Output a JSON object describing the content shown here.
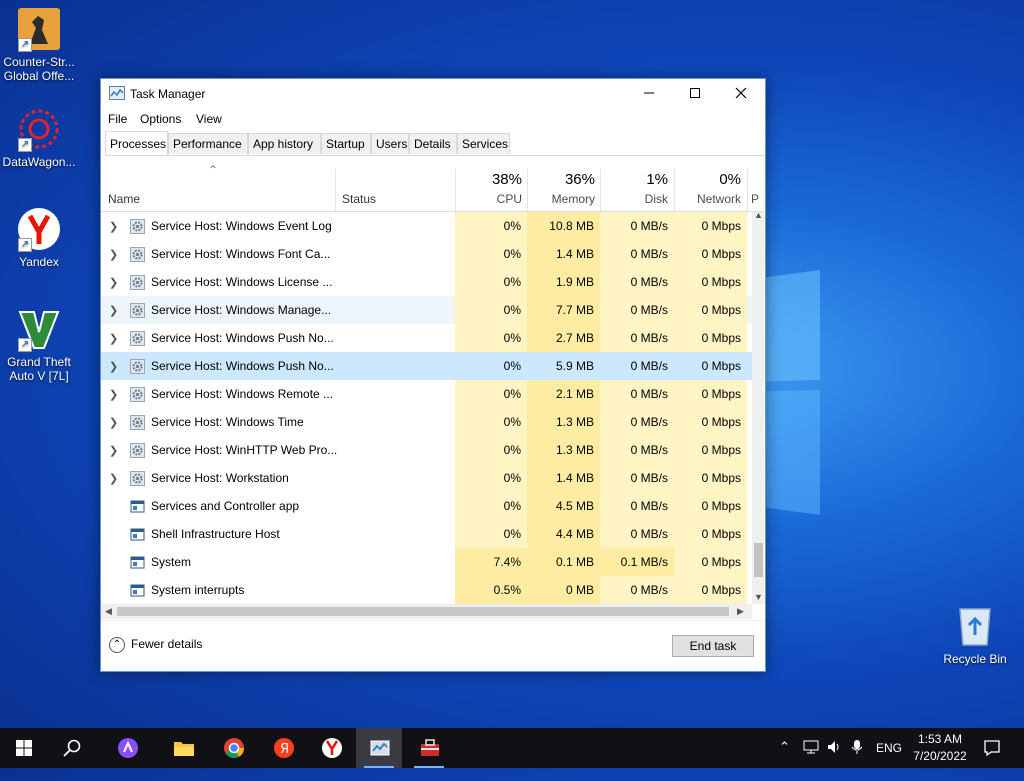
{
  "desktop": {
    "icons": [
      {
        "label": "Counter-Str... Global Offe...",
        "icon": "csgo-icon"
      },
      {
        "label": "DataWagon...",
        "icon": "datawagon-icon"
      },
      {
        "label": "Yandex",
        "icon": "yandex-browser-icon"
      },
      {
        "label": "Grand Theft Auto V [7L]",
        "icon": "gta-icon"
      },
      {
        "label": "Recycle Bin",
        "icon": "recycle-bin-icon"
      }
    ]
  },
  "window": {
    "title": "Task Manager",
    "menu": [
      "File",
      "Options",
      "View"
    ],
    "tabs": [
      "Processes",
      "Performance",
      "App history",
      "Startup",
      "Users",
      "Details",
      "Services"
    ],
    "active_tab": "Processes",
    "columns": {
      "name": "Name",
      "status": "Status",
      "cpu": {
        "pct": "38%",
        "label": "CPU"
      },
      "memory": {
        "pct": "36%",
        "label": "Memory"
      },
      "disk": {
        "pct": "1%",
        "label": "Disk"
      },
      "network": {
        "pct": "0%",
        "label": "Network"
      },
      "next": "P"
    },
    "rows": [
      {
        "name": "Service Host: Windows Event Log",
        "cpu": "0%",
        "memory": "10.8 MB",
        "disk": "0 MB/s",
        "network": "0 Mbps",
        "expandable": true,
        "icon": "gear-icon"
      },
      {
        "name": "Service Host: Windows Font Ca...",
        "cpu": "0%",
        "memory": "1.4 MB",
        "disk": "0 MB/s",
        "network": "0 Mbps",
        "expandable": true,
        "icon": "gear-icon"
      },
      {
        "name": "Service Host: Windows License ...",
        "cpu": "0%",
        "memory": "1.9 MB",
        "disk": "0 MB/s",
        "network": "0 Mbps",
        "expandable": true,
        "icon": "gear-icon"
      },
      {
        "name": "Service Host: Windows Manage...",
        "cpu": "0%",
        "memory": "7.7 MB",
        "disk": "0 MB/s",
        "network": "0 Mbps",
        "expandable": true,
        "icon": "gear-icon",
        "state": "hover"
      },
      {
        "name": "Service Host: Windows Push No...",
        "cpu": "0%",
        "memory": "2.7 MB",
        "disk": "0 MB/s",
        "network": "0 Mbps",
        "expandable": true,
        "icon": "gear-icon"
      },
      {
        "name": "Service Host: Windows Push No...",
        "cpu": "0%",
        "memory": "5.9 MB",
        "disk": "0 MB/s",
        "network": "0 Mbps",
        "expandable": true,
        "icon": "gear-icon",
        "state": "selected"
      },
      {
        "name": "Service Host: Windows Remote ...",
        "cpu": "0%",
        "memory": "2.1 MB",
        "disk": "0 MB/s",
        "network": "0 Mbps",
        "expandable": true,
        "icon": "gear-icon"
      },
      {
        "name": "Service Host: Windows Time",
        "cpu": "0%",
        "memory": "1.3 MB",
        "disk": "0 MB/s",
        "network": "0 Mbps",
        "expandable": true,
        "icon": "gear-icon"
      },
      {
        "name": "Service Host: WinHTTP Web Pro...",
        "cpu": "0%",
        "memory": "1.3 MB",
        "disk": "0 MB/s",
        "network": "0 Mbps",
        "expandable": true,
        "icon": "gear-icon"
      },
      {
        "name": "Service Host: Workstation",
        "cpu": "0%",
        "memory": "1.4 MB",
        "disk": "0 MB/s",
        "network": "0 Mbps",
        "expandable": true,
        "icon": "gear-icon"
      },
      {
        "name": "Services and Controller app",
        "cpu": "0%",
        "memory": "4.5 MB",
        "disk": "0 MB/s",
        "network": "0 Mbps",
        "expandable": false,
        "icon": "app-window-icon"
      },
      {
        "name": "Shell Infrastructure Host",
        "cpu": "0%",
        "memory": "4.4 MB",
        "disk": "0 MB/s",
        "network": "0 Mbps",
        "expandable": false,
        "icon": "app-window-icon"
      },
      {
        "name": "System",
        "cpu": "7.4%",
        "memory": "0.1 MB",
        "disk": "0.1 MB/s",
        "network": "0 Mbps",
        "expandable": false,
        "icon": "app-window-icon"
      },
      {
        "name": "System interrupts",
        "cpu": "0.5%",
        "memory": "0 MB",
        "disk": "0 MB/s",
        "network": "0 Mbps",
        "expandable": false,
        "icon": "app-window-icon"
      }
    ],
    "footer": {
      "fewer_details": "Fewer details",
      "end_task": "End task"
    }
  },
  "taskbar": {
    "items": [
      "windows-start-icon",
      "search-icon",
      "alice-icon",
      "file-explorer-icon",
      "chrome-icon",
      "yandex-icon",
      "yandex-browser-icon",
      "task-manager-icon",
      "toolbox-icon"
    ],
    "tray": {
      "language": "ENG",
      "time": "1:53 AM",
      "date": "7/20/2022"
    }
  },
  "colors": {
    "usage_light": "#fff4c4",
    "usage_medium": "#ffeca3",
    "hover_row": "#eef6fb",
    "selected_row": "#cce8ff",
    "taskbar": "#101015"
  }
}
